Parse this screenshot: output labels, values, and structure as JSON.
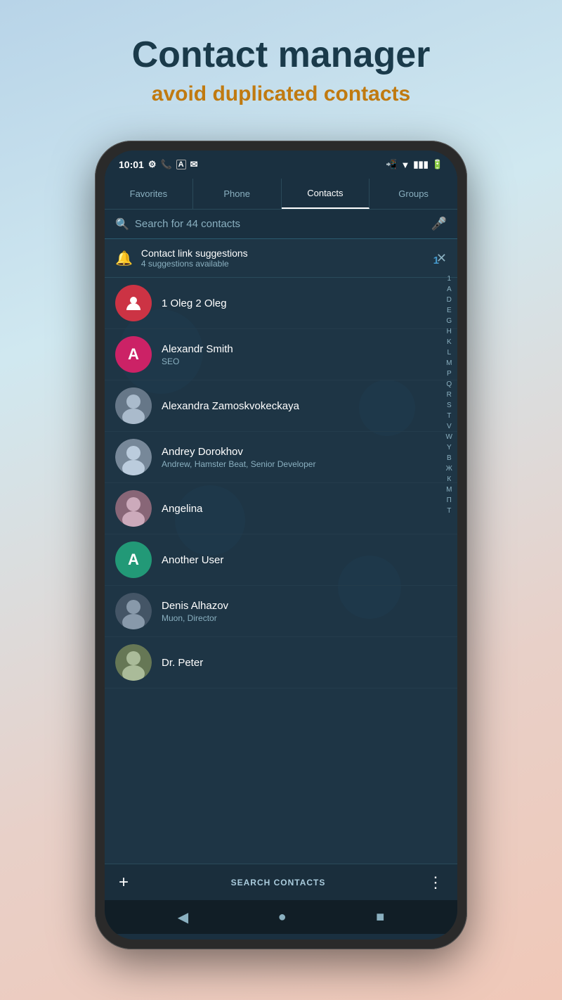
{
  "header": {
    "title": "Contact manager",
    "subtitle": "avoid duplicated contacts"
  },
  "statusBar": {
    "time": "10:01",
    "icons": [
      "settings",
      "phone",
      "A",
      "email"
    ]
  },
  "tabs": [
    {
      "label": "Favorites",
      "active": false
    },
    {
      "label": "Phone",
      "active": false
    },
    {
      "label": "Contacts",
      "active": true
    },
    {
      "label": "Groups",
      "active": false
    }
  ],
  "search": {
    "placeholder": "Search for 44 contacts"
  },
  "suggestion": {
    "title": "Contact link suggestions",
    "subtitle": "4 suggestions available",
    "count": "1"
  },
  "contacts": [
    {
      "id": 1,
      "name": "1 Oleg 2 Oleg",
      "detail": "",
      "avatar_type": "icon",
      "avatar_color": "red"
    },
    {
      "id": 2,
      "name": "Alexandr Smith",
      "detail": "SEO",
      "avatar_type": "letter",
      "letter": "A",
      "avatar_color": "pink"
    },
    {
      "id": 3,
      "name": "Alexandra Zamoskvokeckaya",
      "detail": "",
      "avatar_type": "photo"
    },
    {
      "id": 4,
      "name": "Andrey Dorokhov",
      "detail": "Andrew, Hamster Beat, Senior Developer",
      "avatar_type": "photo"
    },
    {
      "id": 5,
      "name": "Angelina",
      "detail": "",
      "avatar_type": "photo"
    },
    {
      "id": 6,
      "name": "Another User",
      "detail": "",
      "avatar_type": "letter",
      "letter": "A",
      "avatar_color": "teal"
    },
    {
      "id": 7,
      "name": "Denis Alhazov",
      "detail": "Muon, Director",
      "avatar_type": "photo"
    },
    {
      "id": 8,
      "name": "Dr. Peter",
      "detail": "",
      "avatar_type": "photo"
    }
  ],
  "alphabetIndex": [
    "1",
    "A",
    "D",
    "E",
    "G",
    "H",
    "K",
    "L",
    "M",
    "P",
    "Q",
    "R",
    "S",
    "T",
    "V",
    "W",
    "Y",
    "В",
    "Ж",
    "К",
    "М",
    "П",
    "Т"
  ],
  "toolbar": {
    "add_label": "+",
    "search_label": "SEARCH CONTACTS",
    "more_label": "⋮"
  },
  "navBar": {
    "back_label": "◀",
    "home_label": "●",
    "square_label": "■"
  }
}
